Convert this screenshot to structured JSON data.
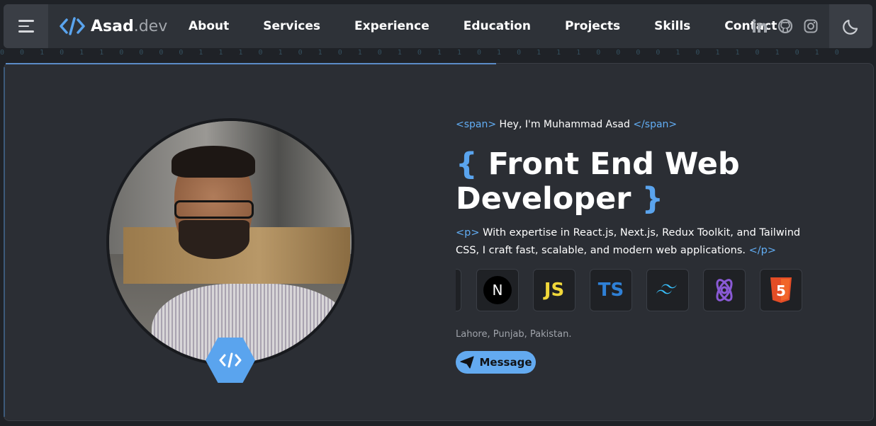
{
  "navbar": {
    "brand_main": "Asad",
    "brand_suffix": ".dev",
    "links": [
      "About",
      "Services",
      "Experience",
      "Education",
      "Projects",
      "Skills",
      "Contact"
    ],
    "socials": [
      "linkedin-icon",
      "github-icon",
      "instagram-icon"
    ],
    "theme_icon": "moon-icon"
  },
  "binary_strip": "0 0 1 0 1 1 0 0 0 0 1 1 1 0 1 0 1 0 1 0 1 0 1 1 0 1 0 1 1 1 0 0 0 0 1 0 1 1 0 1 0 1 0",
  "hero": {
    "intro_open": "<span>",
    "intro_text": " Hey, I'm Muhammad Asad ",
    "intro_close": "</span>",
    "brace_open": "{",
    "title_line1": " Front End Web",
    "title_line2": "Developer ",
    "brace_close": "}",
    "desc_open": "<p>",
    "desc_text": " With expertise in React.js, Next.js, Redux Toolkit, and Tailwind CSS, I craft fast, scalable, and modern web applications. ",
    "desc_close": "</p>",
    "skills": [
      "nextjs-icon",
      "javascript-icon",
      "typescript-icon",
      "tailwind-icon",
      "redux-icon",
      "html5-icon"
    ],
    "skill_labels": {
      "js": "JS",
      "ts": "TS",
      "html": "5",
      "next": "N"
    },
    "location": "Lahore, Punjab, Pakistan.",
    "message_label": "Message"
  },
  "colors": {
    "accent": "#5aa4ee",
    "background": "#1f2227",
    "panel": "#2b2e34"
  }
}
